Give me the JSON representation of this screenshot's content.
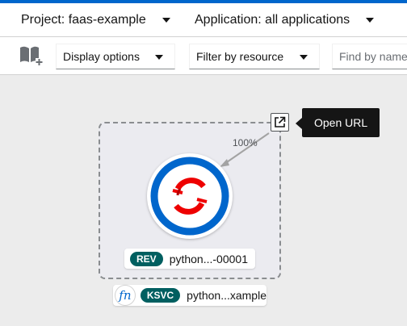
{
  "project_bar": {
    "project_label": "Project: faas-example",
    "application_label": "Application: all applications"
  },
  "toolbar": {
    "display_options": "Display options",
    "filter_by_resource": "Filter by resource",
    "find_placeholder": "Find by name..."
  },
  "topology": {
    "traffic_percent": "100%",
    "revision": {
      "badge": "REV",
      "name": "python...-00001"
    },
    "service": {
      "fn_symbol": "fn",
      "badge": "KSVC",
      "name": "python...xample"
    }
  },
  "tooltip": {
    "text": "Open URL"
  },
  "icons": {
    "topology_quick_search": "book-add-icon",
    "open_url": "external-link-icon",
    "node_logo": "openshift-logo-icon"
  },
  "colors": {
    "accent": "#0066cc",
    "badge": "#005f60",
    "logo_red": "#ee0000",
    "tooltip_bg": "#151515"
  }
}
